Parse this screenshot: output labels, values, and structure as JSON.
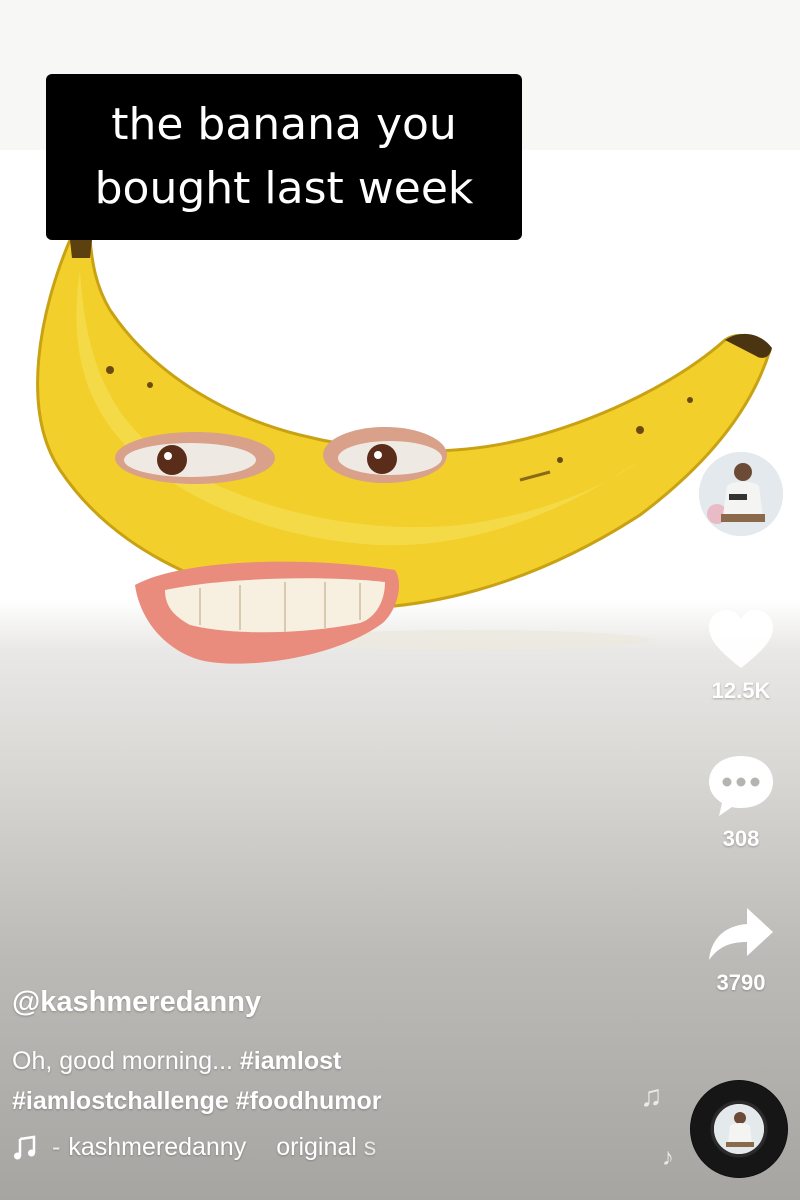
{
  "video": {
    "caption_line1": "the banana you",
    "caption_line2": "bought last week"
  },
  "actions": {
    "likes": "12.5K",
    "comments": "308",
    "shares": "3790"
  },
  "post": {
    "username": "@kashmeredanny",
    "description_text": "Oh, good morning... ",
    "hashtag1": "#iamlost",
    "hashtag2": "#iamlostchallenge",
    "hashtag3": "#foodhumor",
    "music_artist": "kashmeredanny",
    "music_title": "original s"
  },
  "icons": {
    "like": "heart-icon",
    "comment": "comment-bubble-icon",
    "share": "share-arrow-icon",
    "music": "music-note-icon"
  },
  "colors": {
    "caption_bg": "#000000",
    "banana_yellow": "#f2cf2b",
    "text": "#ffffff"
  }
}
